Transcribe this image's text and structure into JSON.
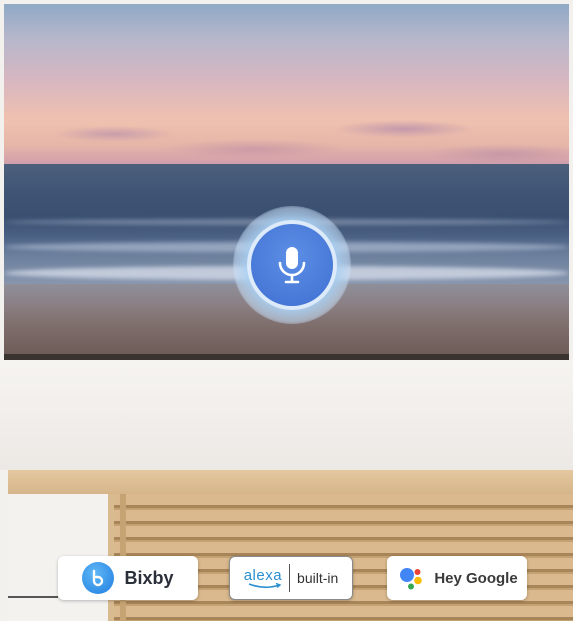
{
  "assistants": {
    "bixby": {
      "label": "Bixby",
      "icon": "bixby-logo-icon",
      "color": "#1f7de0"
    },
    "alexa": {
      "brand": "alexa",
      "suffix": "built-in",
      "icon": "alexa-smile-icon",
      "color": "#2a8fd0"
    },
    "google": {
      "label": "Hey Google",
      "icon": "google-assistant-icon"
    }
  },
  "voice": {
    "icon": "microphone-icon",
    "color": "#3f6fd1"
  }
}
